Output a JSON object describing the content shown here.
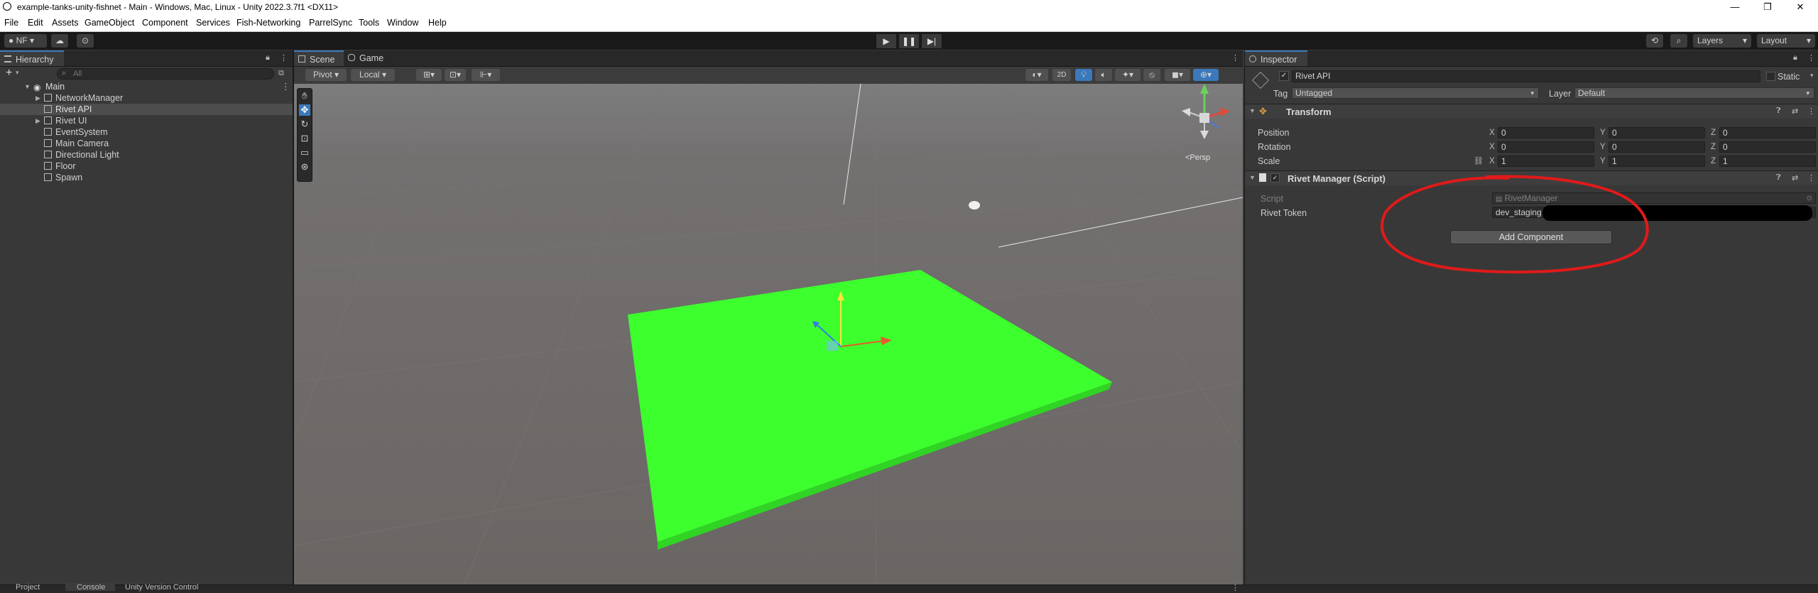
{
  "window": {
    "title": "example-tanks-unity-fishnet - Main - Windows, Mac, Linux - Unity 2022.3.7f1 <DX11>",
    "minimize": "—",
    "maximize": "❐",
    "close": "✕"
  },
  "menu": [
    "File",
    "Edit",
    "Assets",
    "GameObject",
    "Component",
    "Services",
    "Fish-Networking",
    "ParrelSync",
    "Tools",
    "Window",
    "Help"
  ],
  "toolbar": {
    "account": "NF",
    "account_caret": "▾",
    "layers": "Layers",
    "layout": "Layout",
    "play": "▶",
    "pause": "❚❚",
    "step": "▶|"
  },
  "hierarchy": {
    "tab": "Hierarchy",
    "search_placeholder": "All",
    "add": "+",
    "scene": "Main",
    "items": [
      "NetworkManager",
      "Rivet API",
      "Rivet UI",
      "EventSystem",
      "Main Camera",
      "Directional Light",
      "Floor",
      "Spawn"
    ]
  },
  "scene": {
    "tabs": [
      "Scene",
      "Game"
    ],
    "pivot": "Pivot",
    "local": "Local",
    "mode_2d": "2D",
    "persp": "<Persp"
  },
  "inspector": {
    "tab": "Inspector",
    "object_name": "Rivet API",
    "static_label": "Static",
    "tag_label": "Tag",
    "tag_value": "Untagged",
    "layer_label": "Layer",
    "layer_value": "Default",
    "transform": {
      "title": "Transform",
      "rows": [
        {
          "label": "Position",
          "x": "0",
          "y": "0",
          "z": "0"
        },
        {
          "label": "Rotation",
          "x": "0",
          "y": "0",
          "z": "0"
        },
        {
          "label": "Scale",
          "x": "1",
          "y": "1",
          "z": "1"
        }
      ],
      "axis_x": "X",
      "axis_y": "Y",
      "axis_z": "Z"
    },
    "script_component": {
      "title": "Rivet Manager (Script)",
      "script_label": "Script",
      "script_value": "RivetManager",
      "token_label": "Rivet Token",
      "token_value": "dev_staging"
    },
    "add_component": "Add Component"
  },
  "bottom_tabs": [
    "Project",
    "Console",
    "Unity Version Control"
  ],
  "colors": {
    "floor": "#3dff2e",
    "annotation": "#e01a1a",
    "accent": "#3a79bb"
  }
}
